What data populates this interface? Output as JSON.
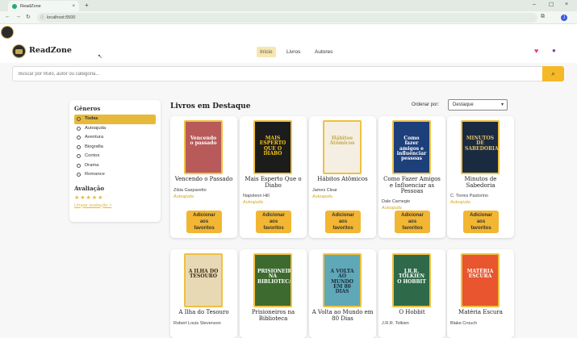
{
  "browser": {
    "tab_title": "ReadZone",
    "tab_close": "×",
    "new_tab": "+",
    "window_controls": [
      "–",
      "☐",
      "×"
    ],
    "url": "localhost:5500",
    "profile_initial": "J"
  },
  "app": {
    "brand": "ReadZone",
    "nav": [
      {
        "label": "Início"
      },
      {
        "label": "Livros"
      },
      {
        "label": "Autores"
      }
    ]
  },
  "search": {
    "placeholder": "Buscar por título, autor ou categoria...",
    "button_icon": "search-icon"
  },
  "sidebar": {
    "genres_title": "Gêneros",
    "genres": [
      "Todas",
      "Autoajuda",
      "Aventura",
      "Biografia",
      "Contos",
      "Drama",
      "Romance"
    ],
    "active_genre": "Todas",
    "rating_title": "Avaliação",
    "stars": "★★★★★",
    "clear_label": "Limpar avaliação ×"
  },
  "main": {
    "section_title": "Livros em Destaque",
    "sort_label": "Ordenar por:",
    "sort_value": "Destaque",
    "add_fav_label": "Adicionar\naos\nfavoritos",
    "books_row1": [
      {
        "title": "Vencendo o Passado",
        "author": "Zibia Gasparetto",
        "genre": "Autoajuda",
        "cover_text": "Vencendo o passado",
        "cover_bg": "#b85a5a",
        "cover_fg": "#fff"
      },
      {
        "title": "Mais Esperto Que o Diabo",
        "author": "Napoleon Hill",
        "genre": "Autoajuda",
        "cover_text": "MAIS ESPERTO QUE O DIABO",
        "cover_bg": "#1c1c1c",
        "cover_fg": "#f5c518"
      },
      {
        "title": "Hábitos Atômicos",
        "author": "James Clear",
        "genre": "Autoajuda",
        "cover_text": "Hábitos Atômicos",
        "cover_bg": "#f4efe2",
        "cover_fg": "#c9a84a"
      },
      {
        "title": "Como Fazer Amigos e Influenciar as Pessoas",
        "author": "Dale Carnegie",
        "genre": "Autoajuda",
        "cover_text": "Como fazer amigos e influenciar pessoas",
        "cover_bg": "#1d3f7a",
        "cover_fg": "#fff"
      },
      {
        "title": "Minutos de Sabedoria",
        "author": "C. Torres Pastorino",
        "genre": "Autoajuda",
        "cover_text": "MINUTOS DE SABEDORIA",
        "cover_bg": "#1a2a40",
        "cover_fg": "#e6c360"
      }
    ],
    "books_row2": [
      {
        "title": "A Ilha do Tesouro",
        "author": "Robert Louis Stevenson",
        "cover_text": "A ILHA DO TESOURO",
        "cover_bg": "#e8d9b5",
        "cover_fg": "#3a2a15"
      },
      {
        "title": "Prisioneiros na Biblioteca",
        "author": "",
        "cover_text": "PRISIONEIROS NA BIBLIOTECA",
        "cover_bg": "#3d6a2e",
        "cover_fg": "#fff"
      },
      {
        "title": "A Volta ao Mundo em 80 Dias",
        "author": "",
        "cover_text": "A VOLTA AO MUNDO EM 80 DIAS",
        "cover_bg": "#5fa8b8",
        "cover_fg": "#1c2a3a"
      },
      {
        "title": "O Hobbit",
        "author": "J.R.R. Tolkien",
        "cover_text": "J.R.R. TOLKIEN O HOBBIT",
        "cover_bg": "#2e6a4a",
        "cover_fg": "#fff"
      },
      {
        "title": "Matéria Escura",
        "author": "Blake Crouch",
        "cover_text": "MATÉRIA ESCURA",
        "cover_bg": "#e8552e",
        "cover_fg": "#fff"
      }
    ]
  }
}
